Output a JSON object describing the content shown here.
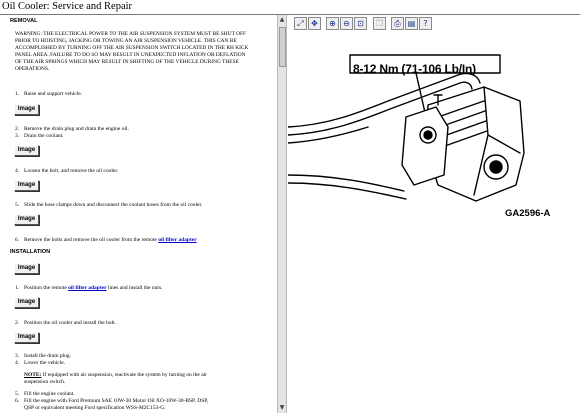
{
  "window": {
    "title": "Oil Cooler:  Service and Repair"
  },
  "left": {
    "removal_heading": "REMOVAL",
    "warning": "WARNING: THE ELECTRICAL POWER TO THE AIR SUSPENSION SYSTEM MUST BE SHUT OFF PRIOR TO HOISTING, JACKING OR TOWING AN AIR SUSPENSION VEHICLE. THIS CAN BE ACCOMPLISHED BY TURNING OFF THE AIR SUSPENSION SWITCH LOCATED IN THE RH KICK PANEL AREA. FAILURE TO DO SO MAY RESULT IN UNEXPECTED INFLATION OR DEFLATION OF THE AIR SPRINGS WHICH MAY RESULT IN SHIFTING OF THE VEHICLE DURING THESE OPERATIONS.",
    "image_label": "Image",
    "removal_steps": [
      {
        "n": "1.",
        "text": "Raise and support vehicle."
      },
      {
        "n": "2.",
        "text": "Remove the drain plug and drain the engine oil."
      },
      {
        "n": "3.",
        "text": "Drain the coolant."
      },
      {
        "n": "4.",
        "text": "Loosen the bolt, and remove the oil cooler."
      },
      {
        "n": "5.",
        "text": "Slide the hose clamps down and disconnect the coolant hoses from the oil cooler."
      },
      {
        "n": "6.",
        "text_before": "Remove the bolts and remove the oil cooler from the remote ",
        "link": "oil filter adapter",
        "text_after": ""
      }
    ],
    "installation_heading": "INSTALLATION",
    "install_steps": [
      {
        "n": "1.",
        "text_before": "Position the remote ",
        "link": "oil filter adapter",
        "text_after": " lines and install the nuts."
      },
      {
        "n": "2.",
        "text": "Position the oil cooler and install the bolt."
      },
      {
        "n": "3.",
        "text": "Install the drain plug."
      },
      {
        "n": "4.",
        "text": "Lower the vehicle."
      }
    ],
    "note_label": "NOTE:",
    "note_text": "If equipped with air suspension, reactivate the system by turning on the air",
    "note_text2": "suspension switch.",
    "final_steps": [
      {
        "n": "5.",
        "text": "Fill the engine coolant."
      },
      {
        "n": "6.",
        "text": "Fill the engine with Ford Premium SAE 10W-30 Motor Oil XO-10W-30-BSP, DSP,"
      },
      {
        "n": "",
        "text": "QSP or equivalent meeting Ford specification WSS-M2C153-G."
      }
    ]
  },
  "toolbar": {
    "buttons": [
      {
        "name": "fit-page-icon",
        "glyph": "⤢"
      },
      {
        "name": "pan-icon",
        "glyph": "✥"
      },
      {
        "name": "zoom-in-icon",
        "glyph": "⊕"
      },
      {
        "name": "zoom-out-icon",
        "glyph": "⊖"
      },
      {
        "name": "zoom-window-icon",
        "glyph": "⊡"
      },
      {
        "name": "copy-icon",
        "glyph": "❐"
      },
      {
        "name": "print-icon",
        "glyph": "⎙"
      },
      {
        "name": "settings-icon",
        "glyph": "▤"
      },
      {
        "name": "help-icon",
        "glyph": "?"
      }
    ]
  },
  "diagram": {
    "torque_callout": "8-12 Nm (71-106 Lb/In)",
    "figure_code": "GA2596-A"
  },
  "colors": {
    "link": "#0000cc",
    "separator": "#7a7a7a",
    "button_bg": "#f0f0f0"
  }
}
